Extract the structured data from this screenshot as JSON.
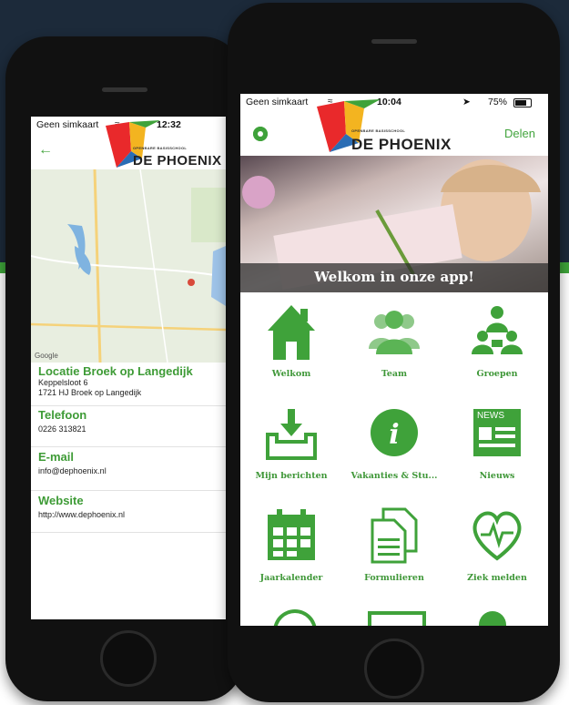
{
  "colors": {
    "brand_green": "#3fa23a",
    "text_dark": "#222222"
  },
  "left_phone": {
    "status": {
      "carrier": "Geen simkaart",
      "time": "12:32"
    },
    "logo": {
      "tagline": "OPENBARE BASISSCHOOL",
      "name": "DE PHOENIX"
    },
    "back_icon": "back-arrow-icon",
    "map": {
      "attribution": "Google"
    },
    "location": {
      "title": "Locatie Broek op Langedijk",
      "address1": "Keppelsloot 6",
      "address2": "1721 HJ Broek op Langedijk"
    },
    "phone": {
      "title": "Telefoon",
      "value": "0226 313821"
    },
    "email": {
      "title": "E-mail",
      "value": "info@dephoenix.nl"
    },
    "website": {
      "title": "Website",
      "value": "http://www.dephoenix.nl"
    }
  },
  "right_phone": {
    "status": {
      "carrier": "Geen simkaart",
      "time": "10:04",
      "battery": "75%"
    },
    "logo": {
      "tagline": "OPENBARE BASISSCHOOL",
      "name": "DE PHOENIX"
    },
    "header": {
      "settings_icon": "gear-icon",
      "share": "Delen"
    },
    "hero": {
      "title": "Welkom in onze app!"
    },
    "tiles": [
      {
        "label": "Welkom",
        "icon": "house-icon"
      },
      {
        "label": "Team",
        "icon": "people-icon"
      },
      {
        "label": "Groepen",
        "icon": "group-icon"
      },
      {
        "label": "Mijn berichten",
        "icon": "inbox-icon"
      },
      {
        "label": "Vakanties & Stu...",
        "icon": "info-icon"
      },
      {
        "label": "Nieuws",
        "icon": "news-icon"
      },
      {
        "label": "Jaarkalender",
        "icon": "calendar-icon"
      },
      {
        "label": "Formulieren",
        "icon": "forms-icon"
      },
      {
        "label": "Ziek melden",
        "icon": "heart-icon"
      }
    ],
    "news_badge": "NEWS"
  }
}
